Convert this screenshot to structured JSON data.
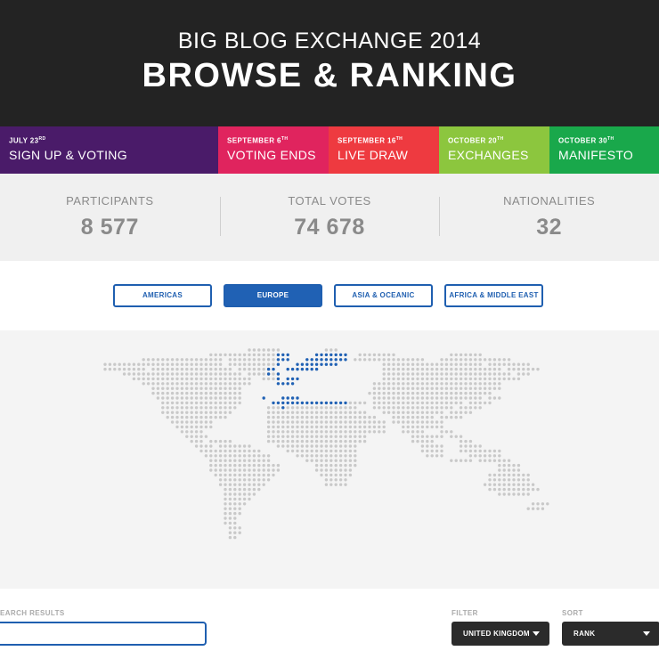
{
  "header": {
    "subtitle": "BIG BLOG EXCHANGE 2014",
    "title": "BROWSE & RANKING"
  },
  "timeline": [
    {
      "date": "JULY 23",
      "sup": "RD",
      "label": "SIGN UP & VOTING",
      "color": "#4a1b69"
    },
    {
      "date": "SEPTEMBER 6",
      "sup": "TH",
      "label": "VOTING ENDS",
      "color": "#e0245e"
    },
    {
      "date": "SEPTEMBER 16",
      "sup": "TH",
      "label": "LIVE DRAW",
      "color": "#ee3a40"
    },
    {
      "date": "OCTOBER 20",
      "sup": "TH",
      "label": "EXCHANGES",
      "color": "#8cc63e"
    },
    {
      "date": "OCTOBER 30",
      "sup": "TH",
      "label": "MANIFESTO",
      "color": "#19a84b"
    }
  ],
  "stats": [
    {
      "label": "PARTICIPANTS",
      "value": "8 577"
    },
    {
      "label": "TOTAL VOTES",
      "value": "74 678"
    },
    {
      "label": "NATIONALITIES",
      "value": "32"
    }
  ],
  "regions": [
    {
      "label": "AMERICAS",
      "active": false
    },
    {
      "label": "EUROPE",
      "active": true
    },
    {
      "label": "ASIA & OCEANIC",
      "active": false
    },
    {
      "label": "AFRICA & MIDDLE EAST",
      "active": false
    }
  ],
  "map": {
    "highlight_region": "EUROPE",
    "dot_color": "#c9c9c9",
    "highlight_color": "#2061b4"
  },
  "controls": {
    "search_label": "EARCH RESULTS",
    "search_value": "",
    "filter_label": "FILTER",
    "filter_value": "UNITED KINGDOM",
    "sort_label": "SORT",
    "sort_value": "RANK"
  },
  "colors": {
    "accent": "#2061b4",
    "header_bg": "#232323",
    "stats_bg": "#f0f0f0"
  }
}
